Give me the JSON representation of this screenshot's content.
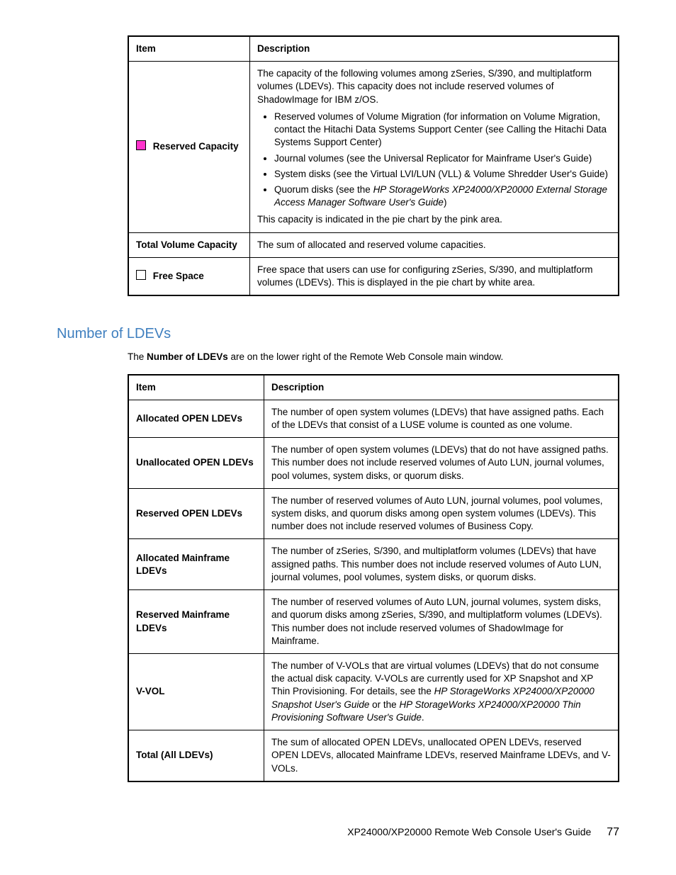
{
  "table1": {
    "headers": {
      "item": "Item",
      "desc": "Description"
    },
    "rows": [
      {
        "swatch": "pink",
        "item": "Reserved Capacity",
        "desc_intro": "The capacity of the following volumes among zSeries, S/390, and multiplatform volumes (LDEVs). This capacity does not include reserved volumes of ShadowImage for IBM z/OS.",
        "bullets": [
          "Reserved volumes of Volume Migration (for information on Volume Migration, contact the Hitachi Data Systems Support Center (see Calling the Hitachi Data Systems Support Center)",
          "Journal volumes (see the Universal Replicator for Mainframe User's Guide)",
          "System disks (see the Virtual LVI/LUN (VLL) & Volume Shredder User's Guide)"
        ],
        "bullet_quorum_pre": "Quorum disks (see the ",
        "bullet_quorum_it": "HP StorageWorks XP24000/XP20000 External Storage Access Manager Software User's Guide",
        "bullet_quorum_post": ")",
        "desc_outro": "This capacity is indicated in the pie chart by the pink area."
      },
      {
        "swatch": null,
        "item": "Total Volume Capacity",
        "desc": "The sum of allocated and reserved volume capacities."
      },
      {
        "swatch": "white",
        "item": "Free Space",
        "desc": "Free space that users can use for configuring zSeries, S/390, and multiplatform volumes (LDEVs). This is displayed in the pie chart by white area."
      }
    ]
  },
  "section_title": "Number of LDEVs",
  "intro_pre": "The ",
  "intro_bold": "Number of LDEVs",
  "intro_post": " are on the lower right of the Remote Web Console main window.",
  "table2": {
    "headers": {
      "item": "Item",
      "desc": "Description"
    },
    "rows": [
      {
        "item": "Allocated OPEN LDEVs",
        "desc": "The number of open system volumes (LDEVs) that have assigned paths. Each of the LDEVs that consist of a LUSE volume is counted as one volume."
      },
      {
        "item": "Unallocated OPEN LDEVs",
        "desc": "The number of open system volumes (LDEVs) that do not have assigned paths. This number does not include reserved volumes of Auto LUN, journal volumes, pool volumes, system disks, or quorum disks."
      },
      {
        "item": "Reserved OPEN LDEVs",
        "desc": "The number of reserved volumes of Auto LUN, journal volumes, pool volumes, system disks, and quorum disks among open system volumes (LDEVs). This number does not include reserved volumes of Business Copy."
      },
      {
        "item": "Allocated Mainframe LDEVs",
        "desc": "The number of zSeries, S/390, and multiplatform volumes (LDEVs) that have assigned paths. This number does not include reserved volumes of Auto LUN, journal volumes, pool volumes, system disks, or quorum disks."
      },
      {
        "item": "Reserved Mainframe LDEVs",
        "desc": "The number of reserved volumes of Auto LUN, journal volumes, system disks, and quorum disks among zSeries, S/390, and multiplatform volumes (LDEVs). This number does not include reserved volumes of ShadowImage for Mainframe."
      },
      {
        "item": "V-VOL",
        "desc_pre": "The number of V-VOLs that are virtual volumes (LDEVs) that do not consume the actual disk capacity. V-VOLs are currently used for XP Snapshot and XP Thin Provisioning. For details, see the ",
        "desc_it1": "HP StorageWorks XP24000/XP20000 Snapshot User's Guide",
        "desc_mid": " or the ",
        "desc_it2": "HP StorageWorks XP24000/XP20000 Thin Provisioning Software User's Guide",
        "desc_post": "."
      },
      {
        "item": "Total (All LDEVs)",
        "desc": "The sum of allocated OPEN LDEVs, unallocated OPEN LDEVs, reserved OPEN LDEVs, allocated Mainframe LDEVs, reserved Mainframe LDEVs, and V-VOLs."
      }
    ]
  },
  "footer": {
    "title": "XP24000/XP20000 Remote Web Console User's Guide",
    "page": "77"
  }
}
